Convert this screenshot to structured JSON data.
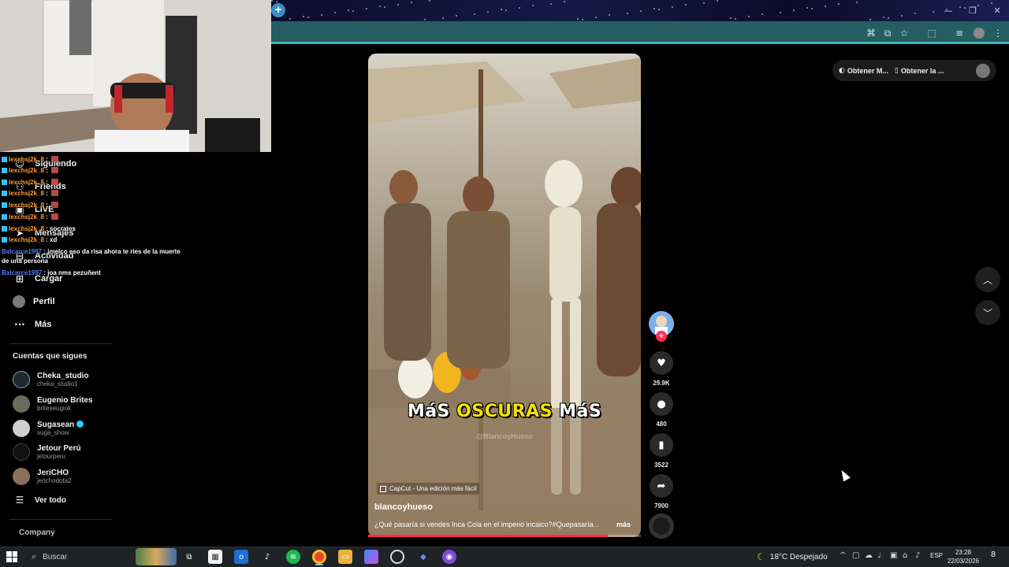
{
  "browser": {
    "new_tab_label": "+",
    "minimize_label": "—",
    "restore_label": "❐",
    "close_label": "✕"
  },
  "sidebar": {
    "nav": [
      {
        "label": "Siguiendo",
        "icon": "following-icon"
      },
      {
        "label": "Friends",
        "icon": "friends-icon"
      },
      {
        "label": "LIVE",
        "icon": "live-icon"
      },
      {
        "label": "Mensajes",
        "icon": "messages-icon"
      },
      {
        "label": "Actividad",
        "icon": "activity-icon"
      },
      {
        "label": "Cargar",
        "icon": "upload-icon"
      },
      {
        "label": "Perfil",
        "icon": "profile-icon"
      },
      {
        "label": "Más",
        "icon": "more-icon"
      }
    ],
    "following_title": "Cuentas que sigues",
    "accounts": [
      {
        "name": "Cheka_studio",
        "handle": "cheka_studio1",
        "verified": false
      },
      {
        "name": "Eugenio Brites",
        "handle": "briteseugiok",
        "verified": false
      },
      {
        "name": "Sugasean",
        "handle": "suga_show",
        "verified": true
      },
      {
        "name": "Jetour Perú",
        "handle": "jetourperu",
        "verified": false
      },
      {
        "name": "JeriCHO",
        "handle": "jerichodota2",
        "verified": false
      }
    ],
    "see_all": "Ver todo",
    "company": "Company"
  },
  "chat": [
    {
      "user": "lexchsj2k_8",
      "text": "",
      "emote": true
    },
    {
      "user": "lexchsj2k_8",
      "text": "",
      "emote": true
    },
    {
      "user": "lexchsj2k_8",
      "text": "",
      "emote": true
    },
    {
      "user": "lexchsj2k_8",
      "text": "",
      "emote": true
    },
    {
      "user": "lexchsj2k_8",
      "text": "",
      "emote": true
    },
    {
      "user": "lexchsj2k_8",
      "text": "",
      "emote": true
    },
    {
      "user": "lexchsj2k_8",
      "text": "",
      "emote": true
    },
    {
      "user": "lexchsj2k_8",
      "text": "socrates",
      "emote": false
    },
    {
      "user": "lexchsj2k_8",
      "text": "xd",
      "emote": false
    },
    {
      "user": "Balcarce1997",
      "text": "jmelco eso da risa ahora te ries de la muerte",
      "emote": false
    },
    {
      "user": "",
      "text": "de una persona",
      "emote": false
    },
    {
      "user": "Balcarce1997",
      "text": "joa nms pezuñent",
      "emote": false
    }
  ],
  "video": {
    "subtitle_parts": [
      "MáS ",
      "OSCURAS",
      " MáS"
    ],
    "watermark": "@BlancoyHueso",
    "capcut_label": "CapCut - Una edición más fácil",
    "author": "blancoyhueso",
    "description": "¿Qué pasaría si vendes Inca Cola en el imperio incaico?#Quepasaría...",
    "more_label": "más",
    "progress": 0.88
  },
  "actions": {
    "likes": "29.9K",
    "comments": "480",
    "saves": "3522",
    "shares": "7900"
  },
  "topbar": {
    "get_coins": "Obtener M...",
    "get_app": "Obtener la ..."
  },
  "taskbar": {
    "search_label": "Buscar",
    "weather": "18°C  Despejado",
    "lang": "ESP",
    "time": "23:28",
    "date": "22/03/2026",
    "notif_count": "8"
  },
  "colors": {
    "address_bar": "#255e62",
    "accent_tiktok": "#fe2c55",
    "subtitle_highlight": "#f6e300",
    "verified": "#20d5ec"
  }
}
